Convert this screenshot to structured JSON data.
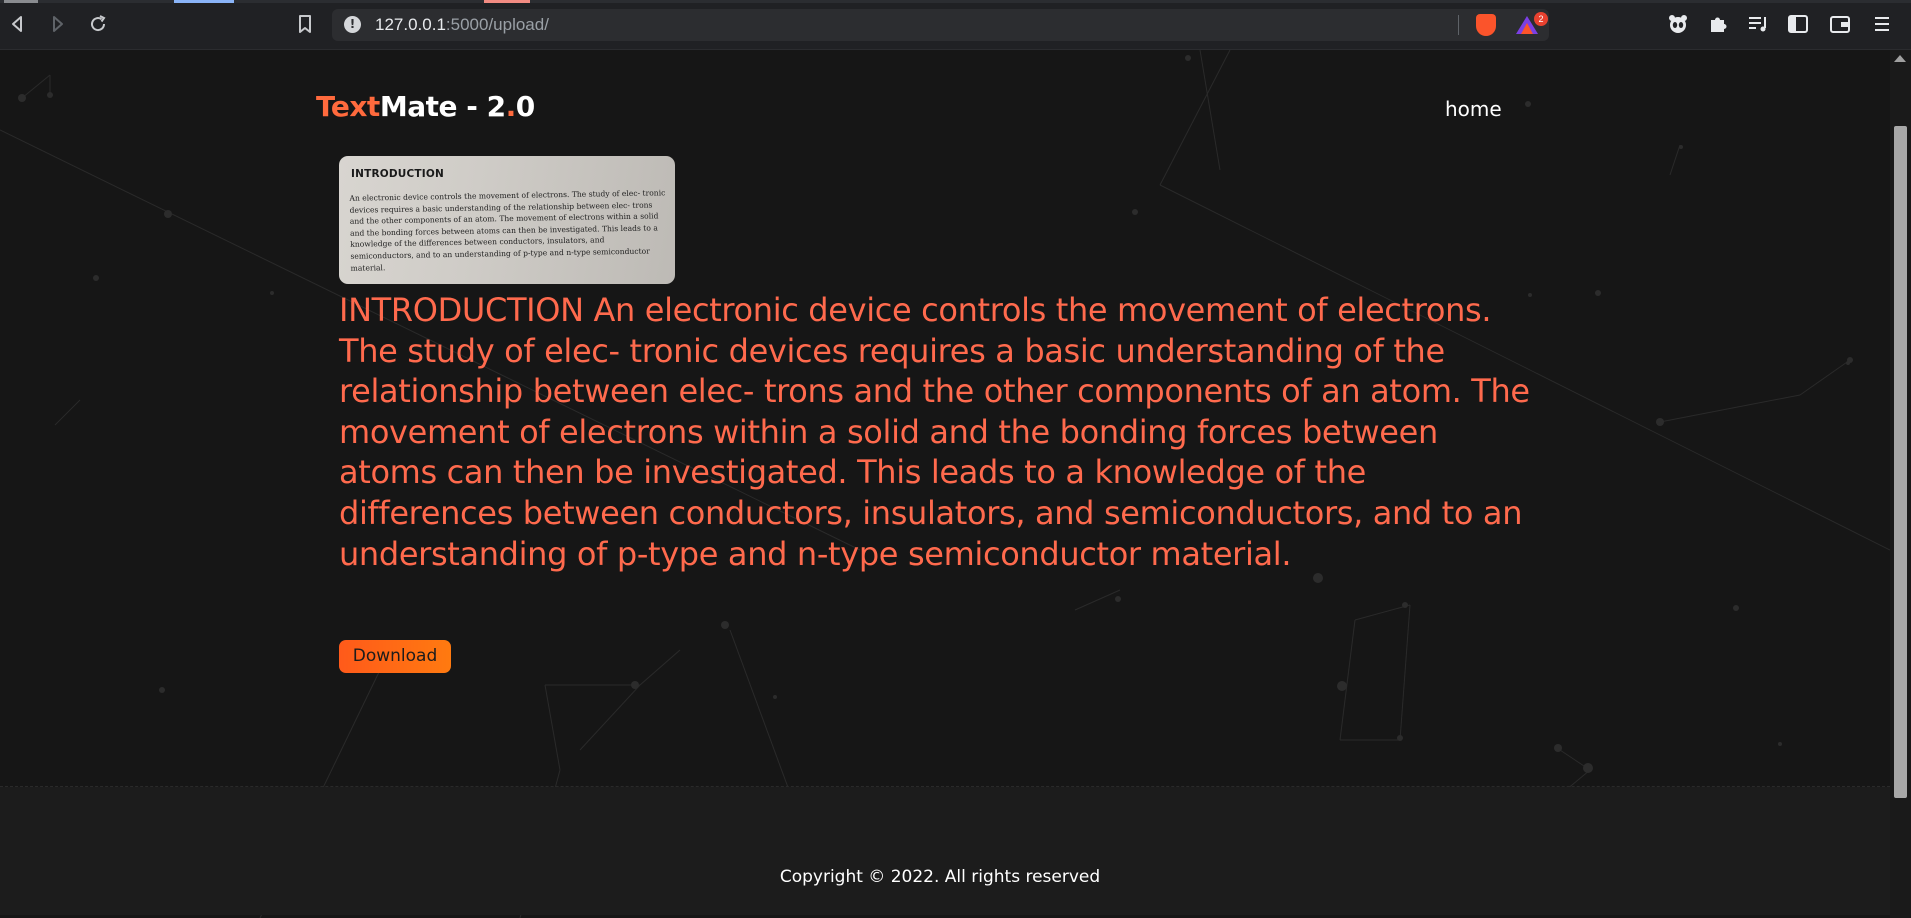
{
  "browser": {
    "url_host": "127.0.0.1",
    "url_path": ":5000/upload/",
    "rewards_badge": "2"
  },
  "header": {
    "brand_part1": "Text",
    "brand_part2": "Mate - 2",
    "brand_dot": ".",
    "brand_part3": "0",
    "nav_home": "home"
  },
  "thumbnail": {
    "title": "INTRODUCTION",
    "body": "An electronic device controls the movement of electrons. The study of elec- tronic devices requires a basic understanding of the relationship between elec- trons and the other components of an atom. The movement of electrons within a solid and the bonding forces between atoms can then be investigated. This leads to a knowledge of the differences between conductors, insulators, and semiconductors, and to an understanding of p-type and n-type semiconductor material."
  },
  "result": {
    "text": "INTRODUCTION An electronic device controls the movement of electrons. The study of elec- tronic devices requires a basic understanding of the relationship between elec- trons and the other components of an atom. The movement of electrons within a solid and the bonding forces between atoms can then be investigated. This leads to a knowledge of the differences between conductors, insulators, and semiconductors, and to an understanding of p-type and n-type semiconductor material.",
    "download_label": "Download"
  },
  "footer": {
    "copyright": "Copyright © 2022. All rights reserved"
  },
  "colors": {
    "accent": "#ff6a3d",
    "text_output": "#ff6a4d",
    "background": "#161616",
    "button_gradient_start": "#ff5a1a",
    "button_gradient_end": "#ff7a10"
  },
  "icons": {
    "back": "back-arrow-icon",
    "forward": "forward-arrow-icon",
    "reload": "reload-icon",
    "bookmark": "bookmark-icon",
    "site_info": "info-icon",
    "brave": "brave-shields-icon",
    "rewards": "brave-rewards-icon",
    "extension_panda": "panda-extension-icon",
    "extensions": "puzzle-icon",
    "playlist": "playlist-icon",
    "sidebar": "sidebar-icon",
    "wallet": "wallet-icon",
    "menu": "menu-icon"
  }
}
